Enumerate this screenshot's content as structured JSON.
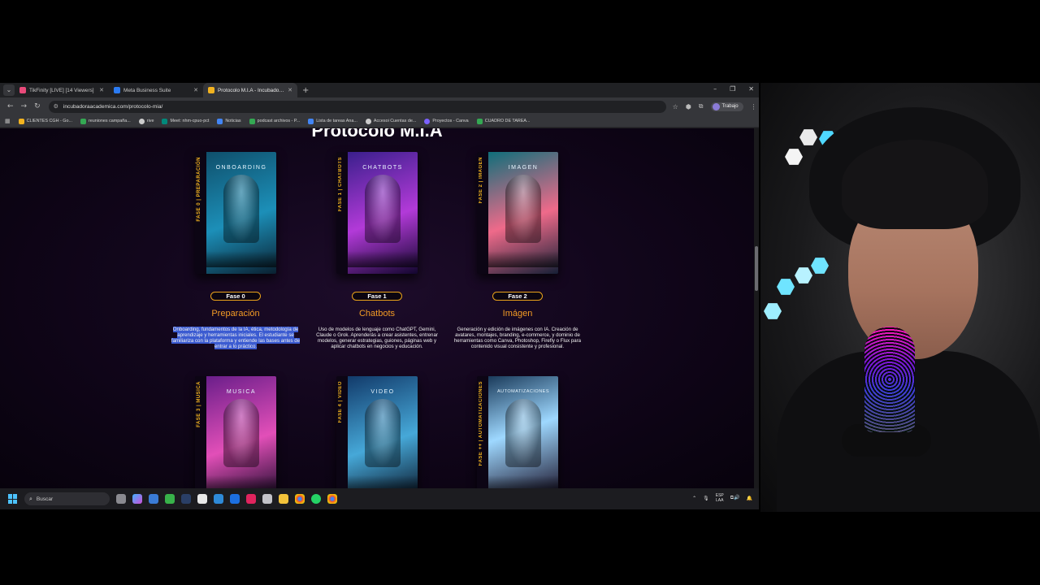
{
  "browser": {
    "tabs": [
      {
        "title": "TikFinity [LIVE] [14 Viewers]",
        "color": "#e84a7a"
      },
      {
        "title": "Meta Business Suite",
        "color": "#2b7bf2"
      },
      {
        "title": "Protocolo M.I.A - Incubadora A",
        "color": "#f2b320"
      }
    ],
    "url": "incubadoraacademica.com/protocolo-mia/",
    "profile": "Trabajo",
    "bookmarks": [
      {
        "label": "CLIENTES CGH - Go...",
        "color": "#f2b320"
      },
      {
        "label": "reuniones campaña...",
        "color": "#34a853"
      },
      {
        "label": "rive",
        "color": "#cccccc"
      },
      {
        "label": "Meet: nhm-cpuo-pct",
        "color": "#00897b"
      },
      {
        "label": "Noticias",
        "color": "#4285f4"
      },
      {
        "label": "podcast archivos - P...",
        "color": "#34a853"
      },
      {
        "label": "Lista de tareas Ana...",
        "color": "#4285f4"
      },
      {
        "label": "Accesoi Cuentas de...",
        "color": "#cccccc"
      },
      {
        "label": "Proyectos - Canva",
        "color": "#7b61ff"
      },
      {
        "label": "CUADRO DE TAREA...",
        "color": "#34a853"
      }
    ]
  },
  "page": {
    "title": "Protocolo M.I.A",
    "phases": [
      {
        "spine": "FASE 0 | PREPARACIÓN",
        "cover": "ONBOARDING",
        "pill": "Fase 0",
        "name": "Preparación",
        "desc": "Onboarding, fundamentos de la IA, ética, metodología de aprendizaje y herramientas iniciales. El estudiante se familiariza con la plataforma y entiende las bases antes de entrar a lo práctico.",
        "colors": [
          "#0f4f6b",
          "#1c8fb8",
          "#0a2030"
        ]
      },
      {
        "spine": "FASE 1 | CHATBOTS",
        "cover": "CHATBOTS",
        "pill": "Fase 1",
        "name": "Chatbots",
        "desc": "Uso de modelos de lenguaje como ChatGPT, Gemini, Claude o Grok. Aprenderás a crear asistentes, entrenar modelos, generar estrategias, guiones, páginas web y aplicar chatbots en negocios y educación.",
        "colors": [
          "#3a1f8c",
          "#b23ad8",
          "#12062e"
        ]
      },
      {
        "spine": "FASE 2 | IMAGEN",
        "cover": "IMAGEN",
        "pill": "Fase 2",
        "name": "Imágen",
        "desc": "Generación y edición de imágenes con IA. Creación de avatares, montajes, branding, e-commerce, y dominio de herramientas como Canva, Photoshop, Firefly o Flux para contenido visual consistente y profesional.",
        "colors": [
          "#0f6f7a",
          "#ef6a8a",
          "#162036"
        ]
      },
      {
        "spine": "FASE 3 | MÚSICA",
        "cover": "MUSICA",
        "pill": "",
        "name": "",
        "desc": "",
        "colors": [
          "#6a1e8a",
          "#e24fb8",
          "#1a0a2a"
        ]
      },
      {
        "spine": "FASE 4 | VIDEO",
        "cover": "VIDEO",
        "pill": "",
        "name": "",
        "desc": "",
        "colors": [
          "#123a6a",
          "#46a8d8",
          "#0a1628"
        ]
      },
      {
        "spine": "FASE ++ | AUTOMATIZACIONES",
        "cover": "AUTOMATIZACIONES",
        "pill": "",
        "name": "",
        "desc": "",
        "colors": [
          "#1a3a5a",
          "#9ed8ff",
          "#140a20"
        ]
      }
    ]
  },
  "taskbar": {
    "search_placeholder": "Buscar",
    "lang": "ESP",
    "region": "LAA"
  }
}
